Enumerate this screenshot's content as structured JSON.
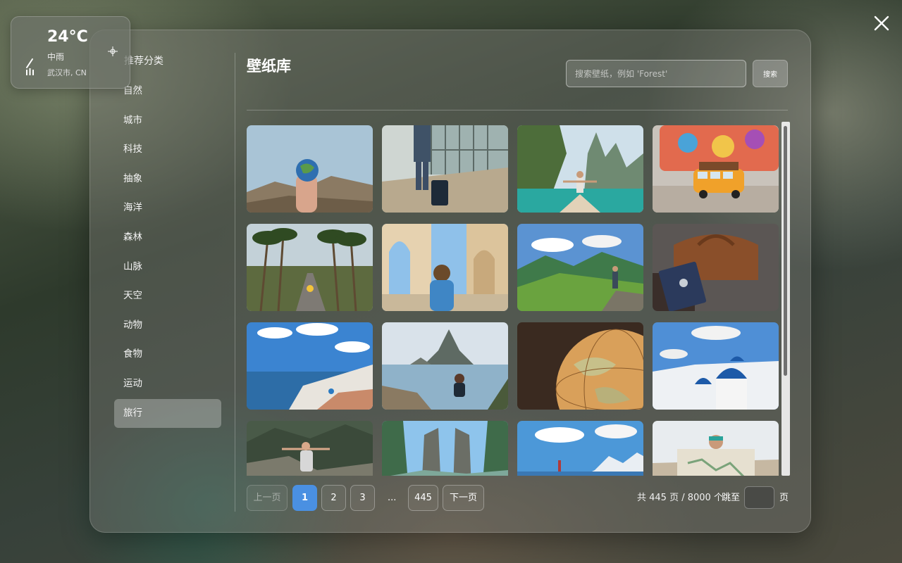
{
  "weather": {
    "temperature": "24°C",
    "condition": "中雨",
    "location": "武汉市, CN",
    "icon": "rain-icon",
    "locate_icon": "locate-icon"
  },
  "sidebar": {
    "title": "推荐分类",
    "items": [
      {
        "label": "自然"
      },
      {
        "label": "城市"
      },
      {
        "label": "科技"
      },
      {
        "label": "抽象"
      },
      {
        "label": "海洋"
      },
      {
        "label": "森林"
      },
      {
        "label": "山脉"
      },
      {
        "label": "天空"
      },
      {
        "label": "动物"
      },
      {
        "label": "食物"
      },
      {
        "label": "运动"
      },
      {
        "label": "旅行"
      }
    ],
    "active": "旅行"
  },
  "main": {
    "title": "壁纸库",
    "search": {
      "placeholder": "搜索壁纸，例如 'Forest'",
      "value": "",
      "button_label": "搜索"
    },
    "thumbnails": [
      {
        "subject": "hand holding globe over mountains"
      },
      {
        "subject": "traveler with suitcase at airport"
      },
      {
        "subject": "woman on boat among limestone cliffs"
      },
      {
        "subject": "toy yellow van with luggage"
      },
      {
        "subject": "palm tree road with scooter"
      },
      {
        "subject": "woman photographing ancient arches"
      },
      {
        "subject": "hiker on green mountain ridge"
      },
      {
        "subject": "leather bag and passport"
      },
      {
        "subject": "Santorini coastline"
      },
      {
        "subject": "man sitting by sea rock island"
      },
      {
        "subject": "antique globe close-up"
      },
      {
        "subject": "Santorini blue domes"
      },
      {
        "subject": "hiker arms open in mountains"
      },
      {
        "subject": "Bali temple gate"
      },
      {
        "subject": "person on lake with snowy peaks"
      },
      {
        "subject": "woman reading map"
      }
    ]
  },
  "pagination": {
    "prev_label": "上一页",
    "pages": [
      "1",
      "2",
      "3"
    ],
    "ellipsis": "...",
    "last_page": "445",
    "next_label": "下一页",
    "current_page": "1",
    "summary": "共 445 页 / 8000 个",
    "jump_label": "跳至",
    "jump_value": "",
    "jump_suffix": "页"
  },
  "window": {
    "close_icon": "close-icon"
  }
}
